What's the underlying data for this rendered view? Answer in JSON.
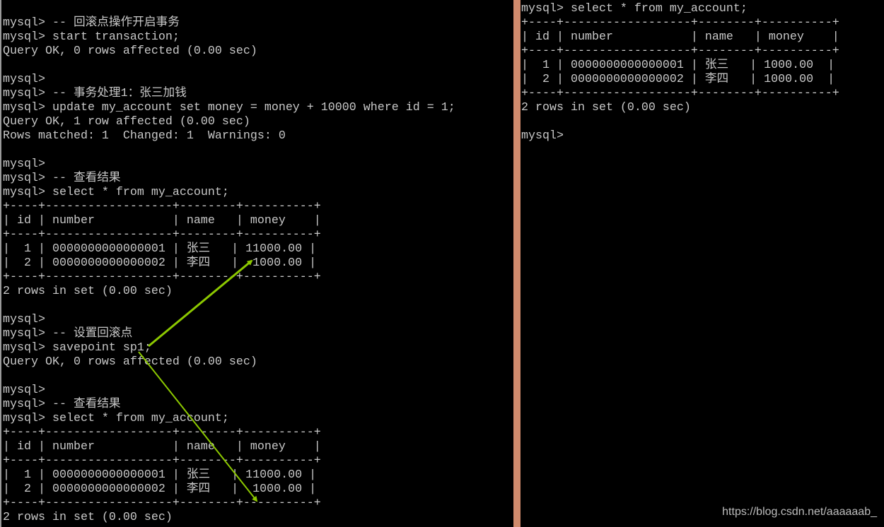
{
  "colors": {
    "background": "#000000",
    "text": "#c8c8c8",
    "divider": "#d08a6c",
    "arrow": "#8cc800"
  },
  "left_terminal": {
    "lines": [
      "mysql> -- 回滚点操作开启事务",
      "mysql> start transaction;",
      "Query OK, 0 rows affected (0.00 sec)",
      "",
      "mysql>",
      "mysql> -- 事务处理1：张三加钱",
      "mysql> update my_account set money = money + 10000 where id = 1;",
      "Query OK, 1 row affected (0.00 sec)",
      "Rows matched: 1  Changed: 1  Warnings: 0",
      "",
      "mysql>",
      "mysql> -- 查看结果",
      "mysql> select * from my_account;",
      "+----+------------------+--------+----------+",
      "| id | number           | name   | money    |",
      "+----+------------------+--------+----------+",
      "|  1 | 0000000000000001 | 张三   | 11000.00 |",
      "|  2 | 0000000000000002 | 李四   |  1000.00 |",
      "+----+------------------+--------+----------+",
      "2 rows in set (0.00 sec)",
      "",
      "mysql>",
      "mysql> -- 设置回滚点",
      "mysql> savepoint sp1;",
      "Query OK, 0 rows affected (0.00 sec)",
      "",
      "mysql>",
      "mysql> -- 查看结果",
      "mysql> select * from my_account;",
      "+----+------------------+--------+----------+",
      "| id | number           | name   | money    |",
      "+----+------------------+--------+----------+",
      "|  1 | 0000000000000001 | 张三   | 11000.00 |",
      "|  2 | 0000000000000002 | 李四   |  1000.00 |",
      "+----+------------------+--------+----------+",
      "2 rows in set (0.00 sec)"
    ]
  },
  "right_terminal": {
    "lines": [
      "mysql> select * from my_account;",
      "+----+------------------+--------+----------+",
      "| id | number           | name   | money    |",
      "+----+------------------+--------+----------+",
      "|  1 | 0000000000000001 | 张三   | 1000.00  |",
      "|  2 | 0000000000000002 | 李四   | 1000.00  |",
      "+----+------------------+--------+----------+",
      "2 rows in set (0.00 sec)",
      "",
      "mysql>"
    ]
  },
  "watermark": "https://blog.csdn.net/aaaaaab_"
}
